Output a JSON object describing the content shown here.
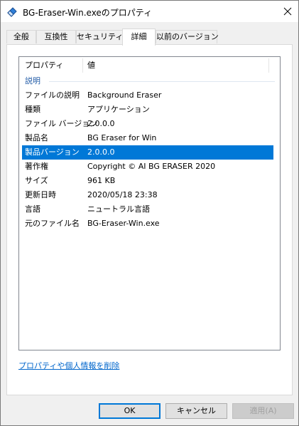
{
  "window": {
    "title": "BG-Eraser-Win.exeのプロパティ",
    "app_icon": "eraser-app-icon",
    "close_icon": "close-icon"
  },
  "tabs": [
    {
      "label": "全般",
      "selected": false
    },
    {
      "label": "互換性",
      "selected": false
    },
    {
      "label": "セキュリティ",
      "selected": false
    },
    {
      "label": "詳細",
      "selected": true
    },
    {
      "label": "以前のバージョン",
      "selected": false
    }
  ],
  "details": {
    "columns": {
      "property": "プロパティ",
      "value": "値"
    },
    "group": "説明",
    "rows": [
      {
        "property": "ファイルの説明",
        "value": "Background Eraser",
        "selected": false
      },
      {
        "property": "種類",
        "value": "アプリケーション",
        "selected": false
      },
      {
        "property": "ファイル バージョン",
        "value": "2.0.0.0",
        "selected": false
      },
      {
        "property": "製品名",
        "value": "BG Eraser for Win",
        "selected": false
      },
      {
        "property": "製品バージョン",
        "value": "2.0.0.0",
        "selected": true
      },
      {
        "property": "著作権",
        "value": "Copyright © AI BG ERASER 2020",
        "selected": false
      },
      {
        "property": "サイズ",
        "value": "961 KB",
        "selected": false
      },
      {
        "property": "更新日時",
        "value": "2020/05/18 23:38",
        "selected": false
      },
      {
        "property": "言語",
        "value": "ニュートラル言語",
        "selected": false
      },
      {
        "property": "元のファイル名",
        "value": "BG-Eraser-Win.exe",
        "selected": false
      }
    ],
    "remove_link": "プロパティや個人情報を削除"
  },
  "buttons": {
    "ok": "OK",
    "cancel": "キャンセル",
    "apply": "適用(A)"
  },
  "colors": {
    "selection": "#0078d7",
    "link": "#0066cc",
    "group_header": "#1f5aa6"
  }
}
